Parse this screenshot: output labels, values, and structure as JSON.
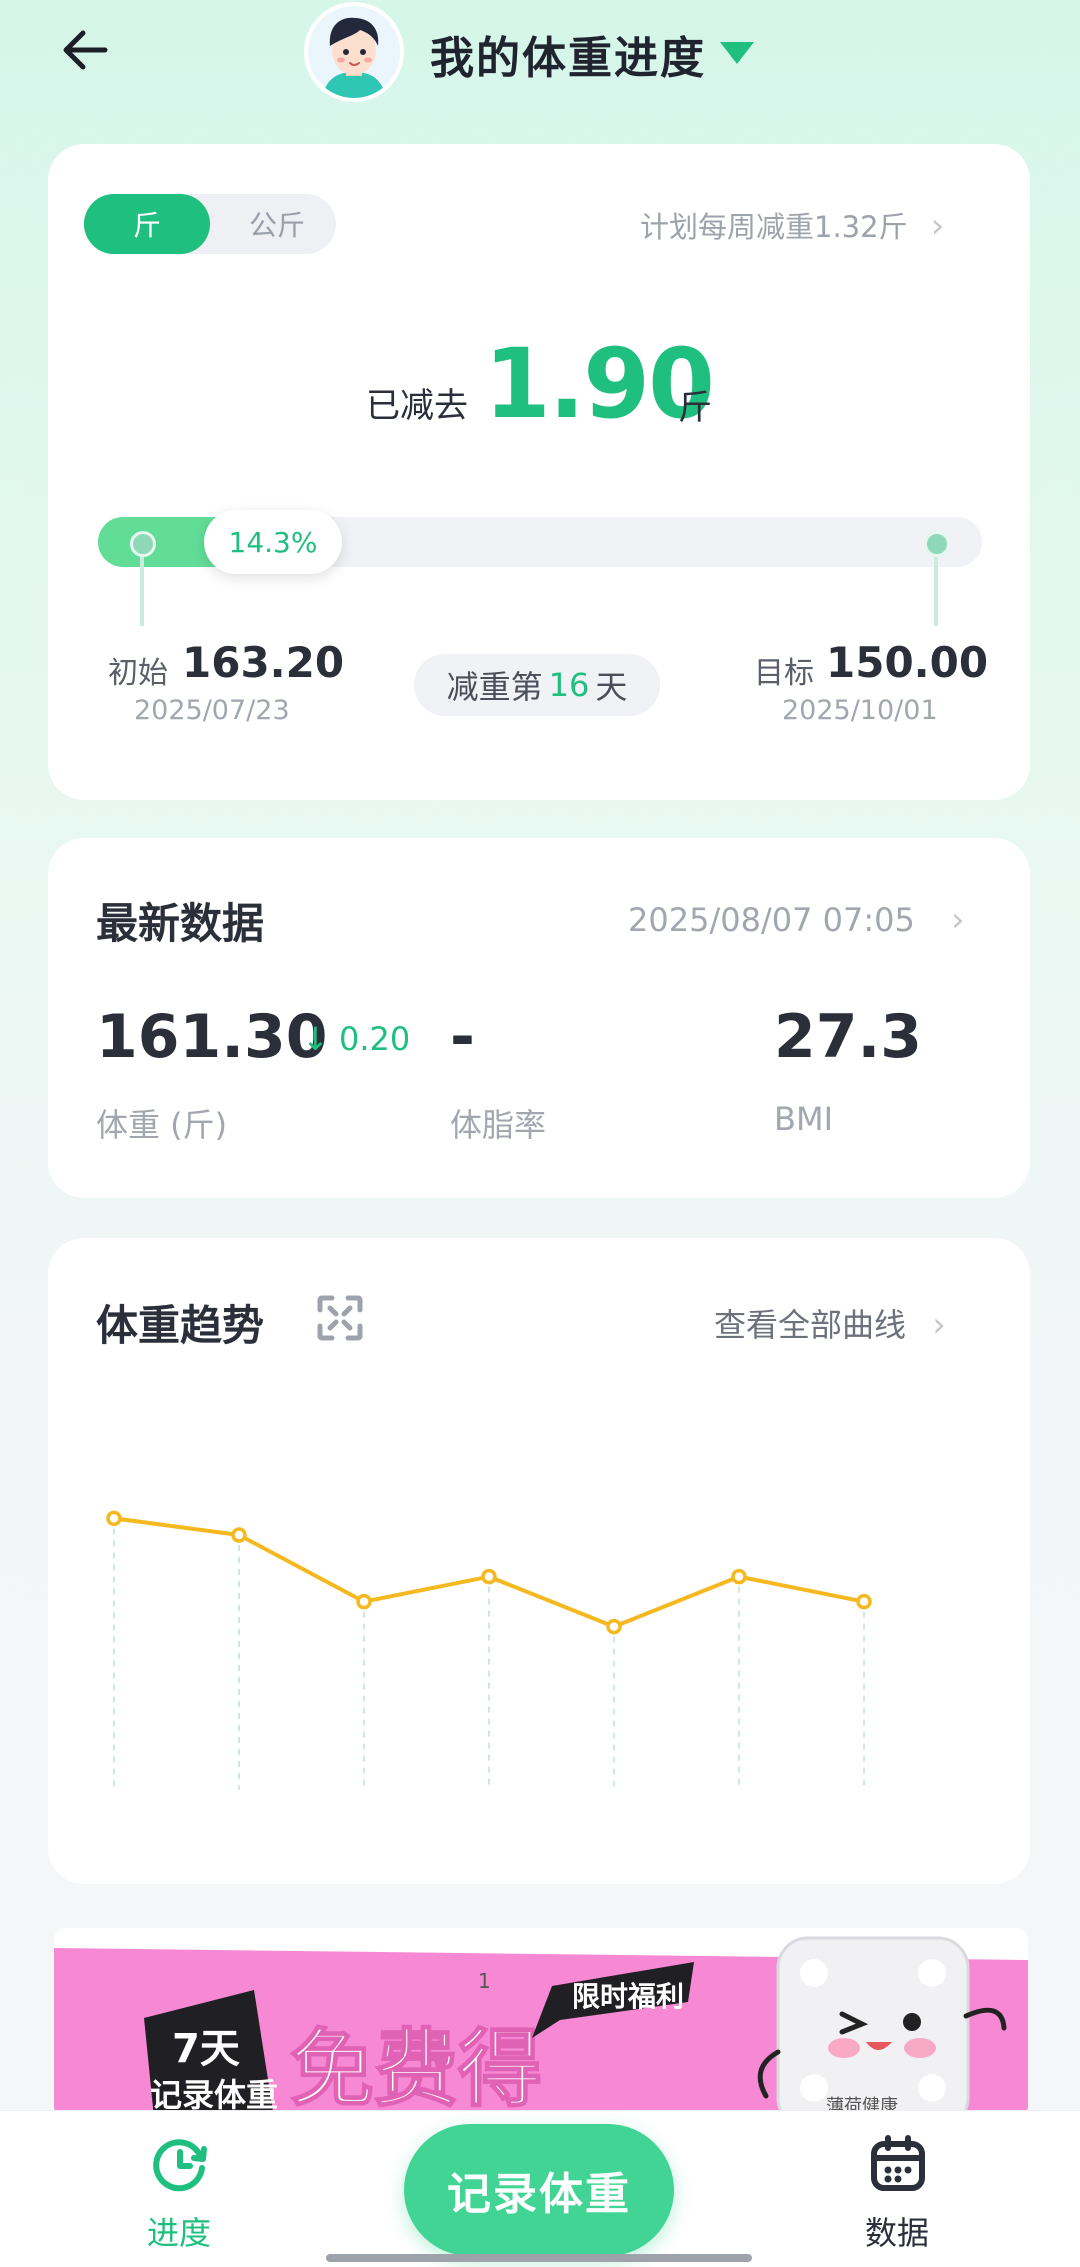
{
  "header": {
    "title": "我的体重进度",
    "avatar_icon": "user-avatar-icon"
  },
  "progress_card": {
    "unit_selected": "斤",
    "unit_other": "公斤",
    "plan_text": "计划每周减重1.32斤",
    "lost_label": "已减去",
    "lost_value": "1.90",
    "lost_unit": "斤",
    "progress_percent": "14.3%",
    "progress_fraction": 0.143,
    "start_label": "初始",
    "start_value": "163.20",
    "start_date": "2025/07/23",
    "day_prefix": "减重第",
    "day_number": "16",
    "day_suffix": "天",
    "goal_label": "目标",
    "goal_value": "150.00",
    "goal_date": "2025/10/01"
  },
  "latest_card": {
    "title": "最新数据",
    "datetime": "2025/08/07 07:05",
    "weight_value": "161.30",
    "weight_delta": "↓ 0.20",
    "weight_label": "体重 (斤)",
    "bodyfat_value": "-",
    "bodyfat_label": "体脂率",
    "bmi_value": "27.3",
    "bmi_label": "BMI"
  },
  "trend_card": {
    "title": "体重趋势",
    "view_all": "查看全部曲线"
  },
  "chart_data": {
    "type": "line",
    "title": "体重趋势",
    "x": [
      1,
      2,
      3,
      4,
      5,
      6,
      7
    ],
    "series": [
      {
        "values": [
          162.6,
          162.4,
          161.6,
          161.9,
          161.3,
          161.9,
          161.6
        ]
      }
    ],
    "ylim": [
      158.5,
      164.5
    ],
    "grid": "vertical dashed",
    "color": "#f5b81e"
  },
  "banner": {
    "text_days": "7天",
    "text_record": "记录体重",
    "text_free": "免费得",
    "text_limited": "限时福利",
    "badge": "1",
    "product_text": "薄荷健康"
  },
  "bottom_nav": {
    "progress_label": "进度",
    "record_label": "记录体重",
    "data_label": "数据"
  },
  "colors": {
    "accent": "#1fbf7f",
    "button": "#41d494",
    "line": "#f5b81e",
    "banner_pink": "#f789d4"
  }
}
